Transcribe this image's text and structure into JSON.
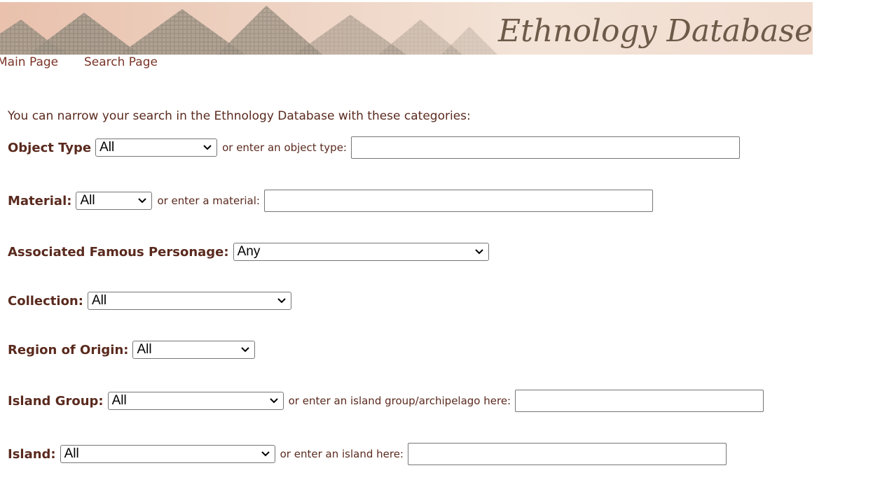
{
  "banner": {
    "title": "Ethnology Database"
  },
  "nav": {
    "main_page": "Main Page",
    "search_page": "Search Page"
  },
  "intro": "You can narrow your search in the Ethnology Database with these categories:",
  "form": {
    "object_type": {
      "label": "Object Type",
      "selected": "All",
      "or_text": "or enter an object type:",
      "value": ""
    },
    "material": {
      "label": "Material:",
      "selected": "All",
      "or_text": "or enter a material:",
      "value": ""
    },
    "personage": {
      "label": "Associated Famous Personage:",
      "selected": "Any"
    },
    "collection": {
      "label": "Collection:",
      "selected": "All"
    },
    "region": {
      "label": "Region of Origin:",
      "selected": "All"
    },
    "island_group": {
      "label": "Island Group:",
      "selected": "All",
      "or_text": "or enter an island group/archipelago here:",
      "value": ""
    },
    "island": {
      "label": "Island:",
      "selected": "All",
      "or_text": "or enter an island here:",
      "value": ""
    }
  },
  "colors": {
    "text": "#5a2a1e",
    "link": "#7a3428",
    "banner_title": "#6d5a48"
  },
  "icons": {
    "dropdown": "chevron-down-icon"
  }
}
